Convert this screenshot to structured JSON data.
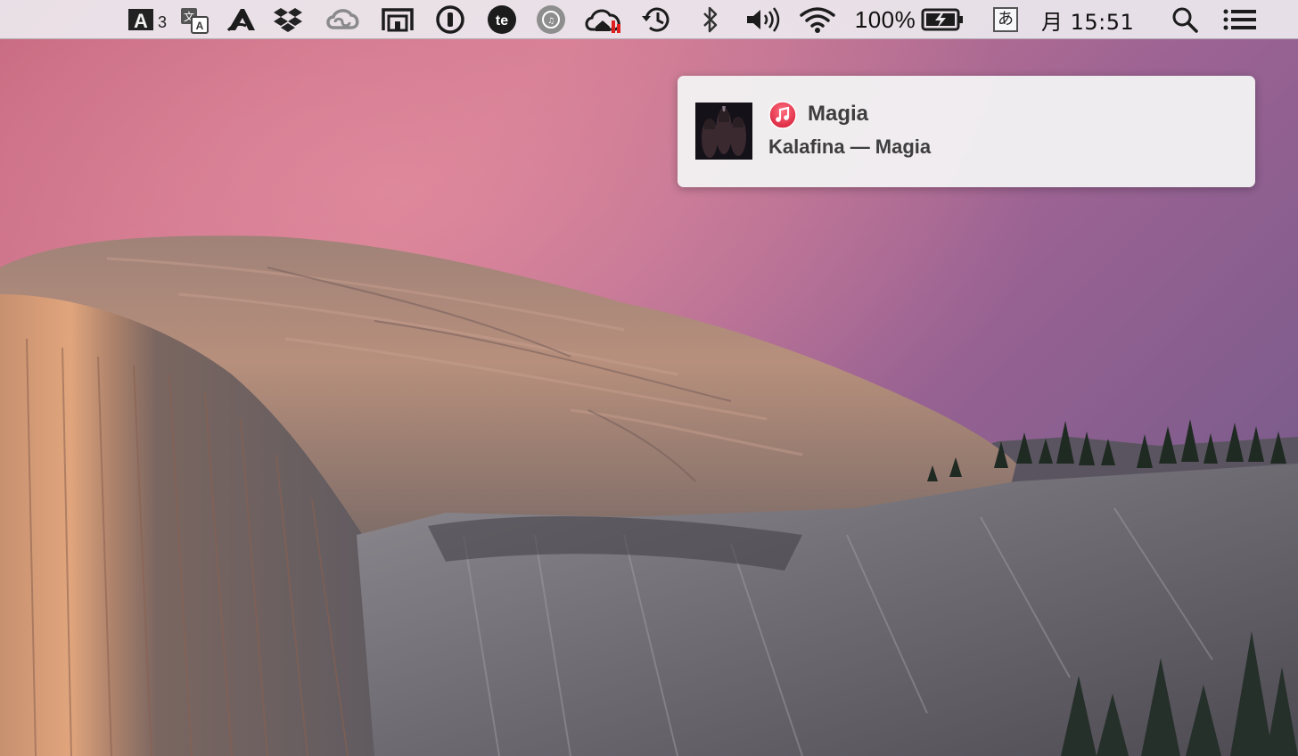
{
  "menubar": {
    "icons": [
      "adobe-acrobat-icon",
      "translate-icon",
      "adobe-application-manager-icon",
      "dropbox-icon",
      "creative-cloud-icon",
      "screen-mirroring-icon",
      "1password-icon",
      "textexpander-icon",
      "music-app-icon",
      "cloud-home-icon",
      "time-machine-icon",
      "bluetooth-icon",
      "volume-icon",
      "wifi-icon",
      "battery-charging-icon",
      "input-method-icon",
      "spotlight-icon",
      "notification-center-icon"
    ],
    "battery_percent": "100%",
    "input_method_label": "あ",
    "clock": "月 15:51"
  },
  "notification": {
    "app_icon": "itunes-icon",
    "title": "Magia",
    "subtitle": "Kalafina — Magia"
  },
  "colors": {
    "menubar_bg": "#ece8ee",
    "notification_bg": "#f2f1f2",
    "itunes_red": "#e8334a"
  }
}
